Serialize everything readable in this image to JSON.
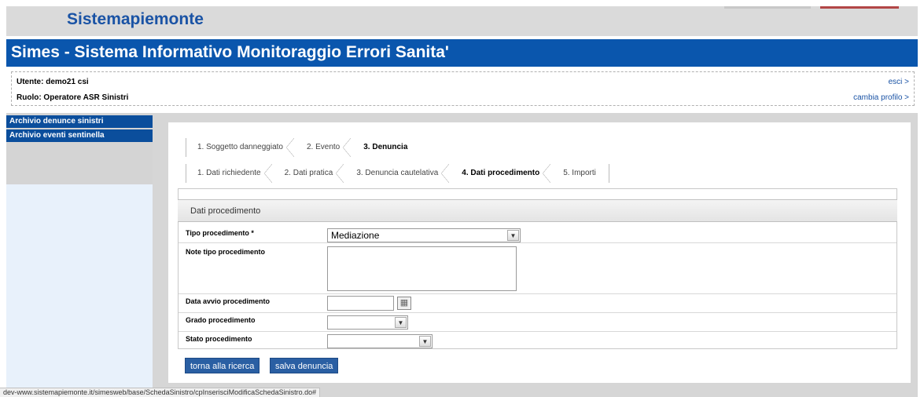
{
  "header": {
    "brand": "Sistemapiemonte",
    "app_title": "Simes - Sistema Informativo Monitoraggio Errori Sanita'"
  },
  "user": {
    "utente": "Utente: demo21 csi",
    "ruolo": "Ruolo: Operatore ASR Sinistri",
    "logout": "esci >",
    "change_profile": "cambia profilo >"
  },
  "sidebar": {
    "items": [
      {
        "label": "Archivio denunce sinistri"
      },
      {
        "label": "Archivio eventi sentinella"
      }
    ]
  },
  "wizard": {
    "main_steps": [
      {
        "label": "1. Soggetto danneggiato"
      },
      {
        "label": "2. Evento"
      },
      {
        "label": "3. Denuncia"
      }
    ],
    "sub_steps": [
      {
        "label": "1. Dati richiedente"
      },
      {
        "label": "2. Dati pratica"
      },
      {
        "label": "3. Denuncia cautelativa"
      },
      {
        "label": "4. Dati procedimento"
      },
      {
        "label": "5. Importi"
      }
    ]
  },
  "form": {
    "section_title": "Dati procedimento",
    "tipo_label": "Tipo procedimento *",
    "tipo_value": "Mediazione",
    "note_label": "Note tipo procedimento",
    "data_label": "Data avvio procedimento",
    "grado_label": "Grado procedimento",
    "stato_label": "Stato procedimento"
  },
  "buttons": {
    "back": "torna alla ricerca",
    "save": "salva denuncia"
  },
  "statusbar": "dev-www.sistemapiemonte.it/simesweb/base/SchedaSinistro/cpInserisciModificaSchedaSinistro.do#"
}
